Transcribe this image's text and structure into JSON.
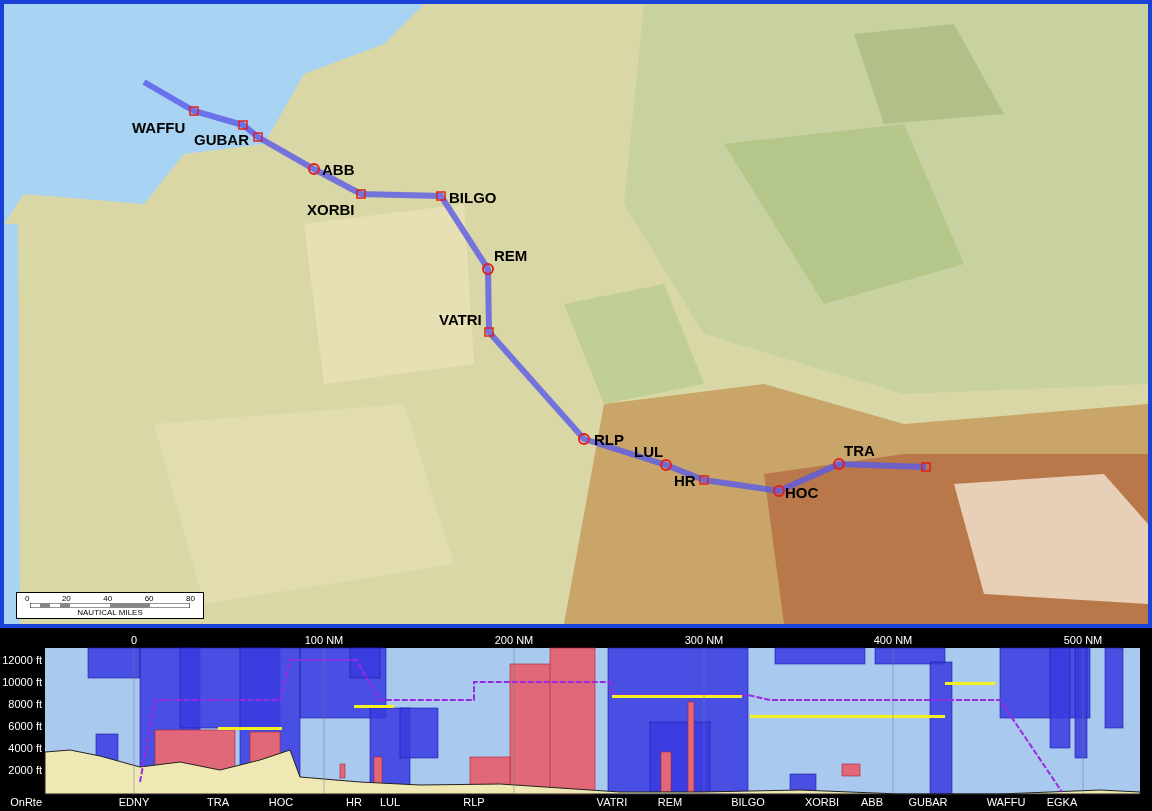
{
  "map": {
    "route": [
      {
        "name": "WAFFU"
      },
      {
        "name": "GUBAR"
      },
      {
        "name": "ABB"
      },
      {
        "name": "XORBI"
      },
      {
        "name": "BILGO"
      },
      {
        "name": "REM"
      },
      {
        "name": "VATRI"
      },
      {
        "name": "RLP"
      },
      {
        "name": "LUL"
      },
      {
        "name": "HR"
      },
      {
        "name": "HOC"
      },
      {
        "name": "TRA"
      }
    ],
    "scale_bar": {
      "ticks": [
        "0",
        "20",
        "40",
        "60",
        "80"
      ],
      "unit": "NAUTICAL MILES"
    }
  },
  "profile": {
    "distance_ticks": [
      "0",
      "100 NM",
      "200 NM",
      "300 NM",
      "400 NM",
      "500 NM"
    ],
    "altitude_ticks": [
      "12000 ft",
      "10000 ft",
      "8000 ft",
      "6000 ft",
      "4000 ft",
      "2000 ft"
    ],
    "baseline_label": "OnRte",
    "waypoints": [
      "EDNY",
      "TRA",
      "HOC",
      "HR",
      "LUL",
      "RLP",
      "VATRI",
      "REM",
      "BILGO",
      "XORBI",
      "ABB",
      "GUBAR",
      "WAFFU",
      "EGKA"
    ]
  }
}
